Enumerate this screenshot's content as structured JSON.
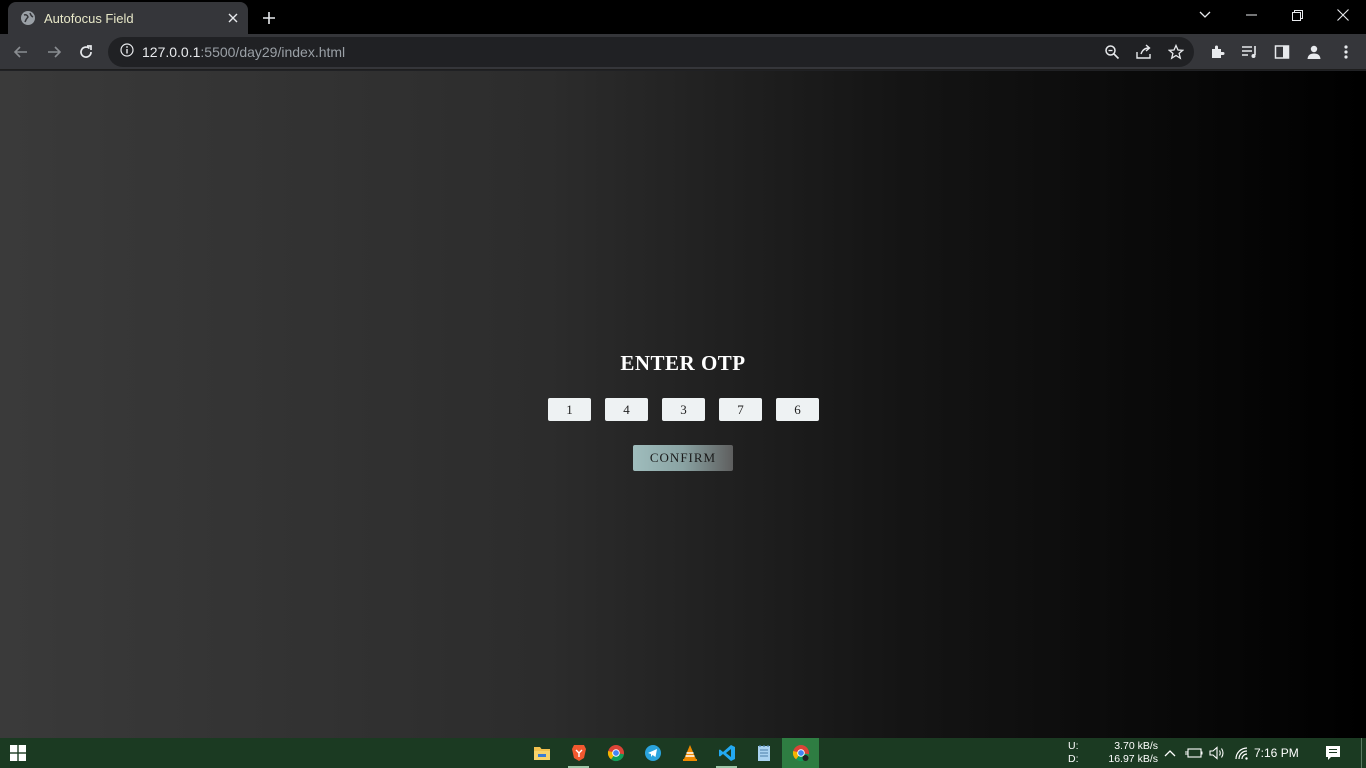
{
  "browser": {
    "tab": {
      "title": "Autofocus Field",
      "favicon": "globe-icon"
    },
    "url": {
      "host": "127.0.0.1",
      "path": ":5500/day29/index.html"
    }
  },
  "page": {
    "title": "ENTER OTP",
    "otp_digits": [
      "1",
      "4",
      "3",
      "7",
      "6"
    ],
    "confirm_label": "CONFIRM"
  },
  "taskbar": {
    "pinned": [
      "file-explorer-icon",
      "brave-icon",
      "chrome-icon",
      "telegram-icon",
      "vlc-icon",
      "vscode-icon",
      "notepad-icon",
      "chrome-active-icon"
    ],
    "net_upload_label": "U:",
    "net_upload": "3.70 kB/s",
    "net_download_label": "D:",
    "net_download": "16.97 kB/s",
    "time": "7:16 PM"
  },
  "colors": {
    "taskbar_bg": "#1b3a22",
    "tab_title": "#e8e8c8",
    "page_gradient_start": "#3a3a3a",
    "page_gradient_end": "#000000"
  }
}
